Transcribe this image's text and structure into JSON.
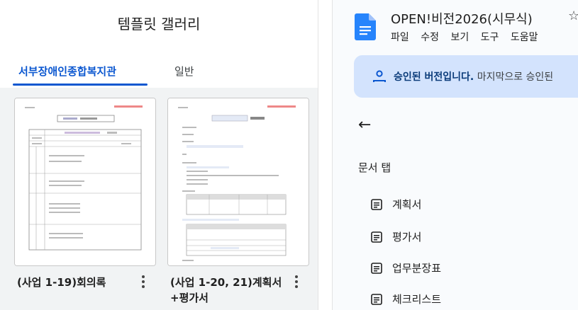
{
  "gallery": {
    "title": "템플릿 갤러리",
    "tabs": [
      {
        "label": "서부장애인종합복지관",
        "active": true
      },
      {
        "label": "일반",
        "active": false
      }
    ],
    "templates": [
      {
        "label": "(사업 1-19)회의록",
        "thumb_heading": "회의록"
      },
      {
        "label": "(사업 1-20, 21)계획서+평가서",
        "thumb_heading": "계획서"
      }
    ]
  },
  "doc": {
    "title": "OPEN!비전2026(시무식)",
    "icon": "google-docs-icon",
    "menu": [
      "파일",
      "수정",
      "보기",
      "도구",
      "도움말"
    ],
    "banner": {
      "bold": "승인된 버전입니다.",
      "rest": "마지막으로 승인된"
    },
    "doc_tabs_title": "문서 탭",
    "doc_tabs": [
      "계획서",
      "평가서",
      "업무분장표",
      "체크리스트"
    ]
  },
  "colors": {
    "accent": "#0b57d0",
    "banner_bg": "#d3e3fd",
    "gallery_bg": "#f1f3f4"
  }
}
